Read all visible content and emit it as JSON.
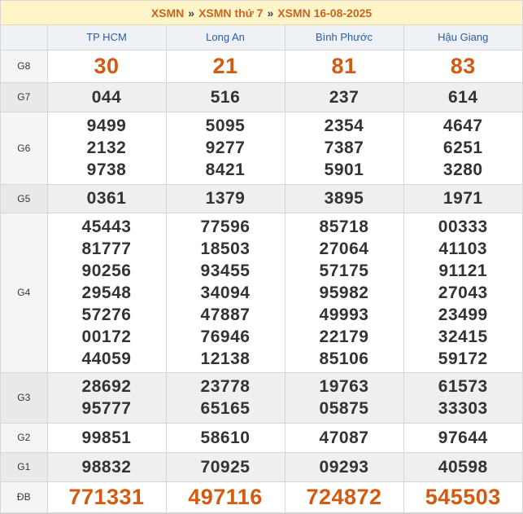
{
  "breadcrumb": {
    "items": [
      "XSMN",
      "XSMN thứ 7",
      "XSMN 16-08-2025"
    ],
    "separator": "»"
  },
  "provinces": [
    "TP HCM",
    "Long An",
    "Bình Phước",
    "Hậu Giang"
  ],
  "prizes": [
    {
      "label": "G8",
      "values": [
        [
          "30"
        ],
        [
          "21"
        ],
        [
          "81"
        ],
        [
          "83"
        ]
      ]
    },
    {
      "label": "G7",
      "values": [
        [
          "044"
        ],
        [
          "516"
        ],
        [
          "237"
        ],
        [
          "614"
        ]
      ]
    },
    {
      "label": "G6",
      "values": [
        [
          "9499",
          "2132",
          "9738"
        ],
        [
          "5095",
          "9277",
          "8421"
        ],
        [
          "2354",
          "7387",
          "5901"
        ],
        [
          "4647",
          "6251",
          "3280"
        ]
      ]
    },
    {
      "label": "G5",
      "values": [
        [
          "0361"
        ],
        [
          "1379"
        ],
        [
          "3895"
        ],
        [
          "1971"
        ]
      ]
    },
    {
      "label": "G4",
      "values": [
        [
          "45443",
          "81777",
          "90256",
          "29548",
          "57276",
          "00172",
          "44059"
        ],
        [
          "77596",
          "18503",
          "93455",
          "34094",
          "47887",
          "76946",
          "12138"
        ],
        [
          "85718",
          "27064",
          "57175",
          "95982",
          "49993",
          "22179",
          "85106"
        ],
        [
          "00333",
          "41103",
          "91121",
          "27043",
          "23499",
          "32415",
          "59172"
        ]
      ]
    },
    {
      "label": "G3",
      "values": [
        [
          "28692",
          "95777"
        ],
        [
          "23778",
          "65165"
        ],
        [
          "19763",
          "05875"
        ],
        [
          "61573",
          "33303"
        ]
      ]
    },
    {
      "label": "G2",
      "values": [
        [
          "99851"
        ],
        [
          "58610"
        ],
        [
          "47087"
        ],
        [
          "97644"
        ]
      ]
    },
    {
      "label": "G1",
      "values": [
        [
          "98832"
        ],
        [
          "70925"
        ],
        [
          "09293"
        ],
        [
          "40598"
        ]
      ]
    },
    {
      "label": "ĐB",
      "values": [
        [
          "771331"
        ],
        [
          "497116"
        ],
        [
          "724872"
        ],
        [
          "545503"
        ]
      ]
    }
  ],
  "colors": {
    "accent": "#d35a0f",
    "header_text": "#2a5ba6",
    "breadcrumb_bg": "#fff5c8"
  }
}
